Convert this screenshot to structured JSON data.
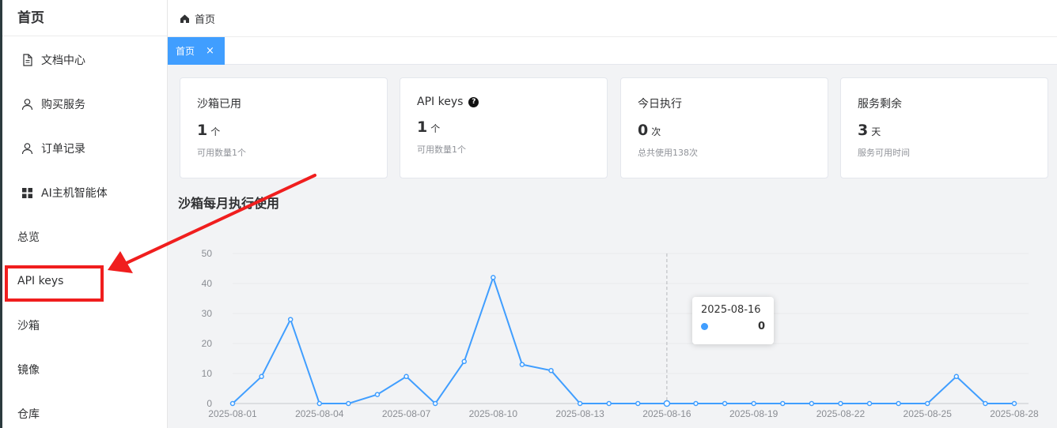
{
  "sidebar": {
    "brand": "首页",
    "items": [
      {
        "label": "文档中心",
        "icon": "document-icon"
      },
      {
        "label": "购买服务",
        "icon": "user-icon"
      },
      {
        "label": "订单记录",
        "icon": "user-icon"
      },
      {
        "label": "AI主机智能体",
        "icon": "grid-icon"
      },
      {
        "label": "总览"
      },
      {
        "label": "API keys"
      },
      {
        "label": "沙箱"
      },
      {
        "label": "镜像"
      },
      {
        "label": "仓库"
      }
    ]
  },
  "breadcrumb": {
    "icon": "home-icon",
    "label": "首页"
  },
  "tabs": [
    {
      "label": "首页",
      "close": "×"
    }
  ],
  "cards": [
    {
      "title": "沙箱已用",
      "value": "1",
      "unit": "个",
      "sub": "可用数量1个"
    },
    {
      "title": "API keys",
      "value": "1",
      "unit": "个",
      "sub": "可用数量1个",
      "help": "?"
    },
    {
      "title": "今日执行",
      "value": "0",
      "unit": "次",
      "sub": "总共使用138次"
    },
    {
      "title": "服务剩余",
      "value": "3",
      "unit": "天",
      "sub": "服务可用时间"
    }
  ],
  "chart_title": "沙箱每月执行使用",
  "chart_data": {
    "type": "line",
    "x": [
      "2025-08-01",
      "2025-08-02",
      "2025-08-03",
      "2025-08-04",
      "2025-08-05",
      "2025-08-06",
      "2025-08-07",
      "2025-08-08",
      "2025-08-09",
      "2025-08-10",
      "2025-08-11",
      "2025-08-12",
      "2025-08-13",
      "2025-08-14",
      "2025-08-15",
      "2025-08-16",
      "2025-08-17",
      "2025-08-18",
      "2025-08-19",
      "2025-08-20",
      "2025-08-21",
      "2025-08-22",
      "2025-08-23",
      "2025-08-24",
      "2025-08-25",
      "2025-08-26",
      "2025-08-27",
      "2025-08-28"
    ],
    "tick_labels": [
      "2025-08-01",
      "2025-08-04",
      "2025-08-07",
      "2025-08-10",
      "2025-08-13",
      "2025-08-16",
      "2025-08-19",
      "2025-08-22",
      "2025-08-25",
      "2025-08-28"
    ],
    "series": [
      {
        "values": [
          0,
          9,
          28,
          0,
          0,
          3,
          9,
          0,
          14,
          42,
          13,
          11,
          0,
          0,
          0,
          0,
          0,
          0,
          0,
          0,
          0,
          0,
          0,
          0,
          0,
          9,
          0,
          0
        ],
        "color": "#409eff"
      }
    ],
    "yticks": [
      0,
      10,
      20,
      30,
      40,
      50
    ],
    "ylim": [
      0,
      50
    ],
    "grid": true
  },
  "tooltip": {
    "date": "2025-08-16",
    "value": "0",
    "color": "#409eff"
  },
  "annotation_color": "#f01e1e"
}
